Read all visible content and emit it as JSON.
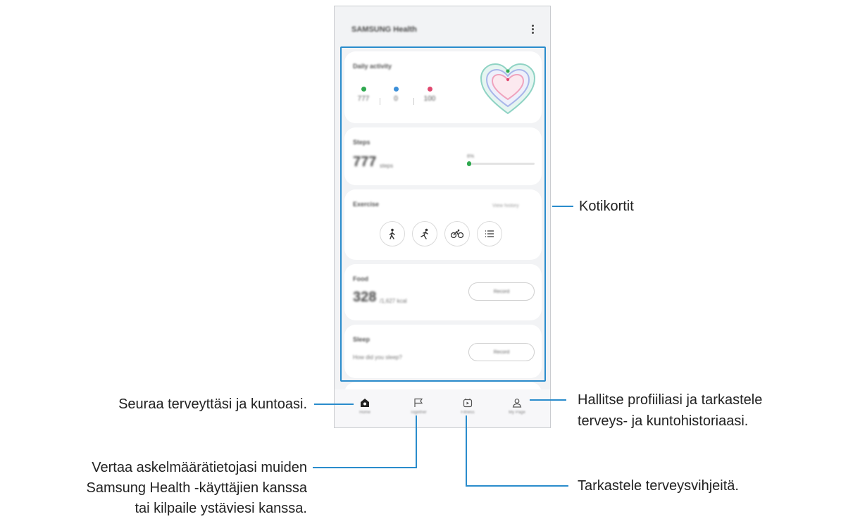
{
  "app": {
    "title": "SAMSUNG Health"
  },
  "cards": {
    "daily_activity": {
      "title": "Daily activity",
      "steps": "777",
      "active_minutes": "0",
      "calories": "100"
    },
    "steps": {
      "title": "Steps",
      "value": "777",
      "unit": "steps",
      "goal_label": "6%",
      "progress": 0.06
    },
    "exercise": {
      "title": "Exercise",
      "view_history": "View history",
      "buttons": [
        "walking-icon",
        "running-icon",
        "cycling-icon",
        "list-icon"
      ]
    },
    "food": {
      "title": "Food",
      "value": "328",
      "unit": "/1,627 kcal",
      "button_label": "Record"
    },
    "sleep": {
      "title": "Sleep",
      "question": "How did you sleep?",
      "button_label": "Record"
    }
  },
  "nav": {
    "home": "Home",
    "together": "Together",
    "fitness": "Fitness",
    "my_page": "My Page"
  },
  "callouts": {
    "home_cards": "Kotikortit",
    "home_tab": "Seuraa terveyttäsi ja kuntoasi.",
    "profile_tab_line1": "Hallitse profiiliasi ja tarkastele",
    "profile_tab_line2": "terveys- ja kuntohistoriaasi.",
    "together_tab_line1": "Vertaa askelmäärätietojasi muiden",
    "together_tab_line2": "Samsung Health -käyttäjien kanssa",
    "together_tab_line3": "tai kilpaile ystäviesi kanssa.",
    "fitness_tab": "Tarkastele terveysvihjeitä."
  },
  "colors": {
    "accent_line": "#2a8ccc",
    "steps_green": "#2fa84f",
    "active_blue": "#3b8fd9",
    "calories_pink": "#e0476e"
  }
}
